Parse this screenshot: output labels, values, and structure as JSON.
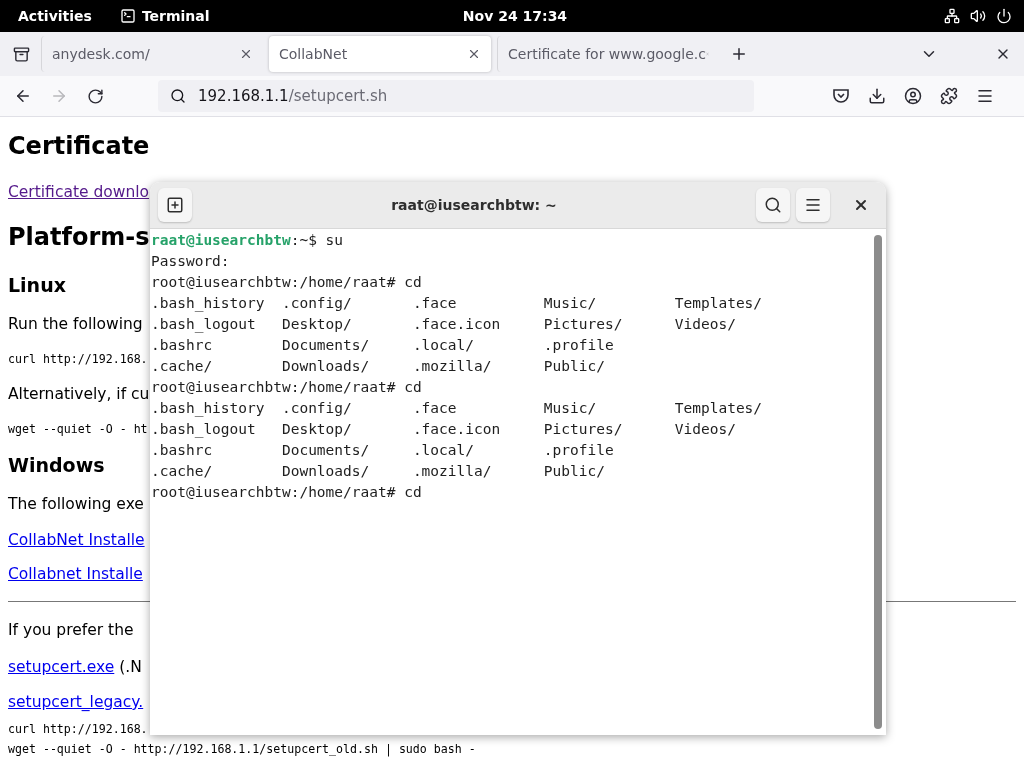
{
  "top_bar": {
    "activities": "Activities",
    "app": "Terminal",
    "clock": "Nov 24  17:34"
  },
  "browser": {
    "tabs": [
      {
        "title": "anydesk.com/",
        "selected": false
      },
      {
        "title": "CollabNet",
        "selected": true
      },
      {
        "title": "Certificate for www.google.c",
        "selected": false
      }
    ],
    "forward_disabled": true,
    "address": {
      "host": "192.168.1.1",
      "path": "/setupcert.sh"
    }
  },
  "page": [
    {
      "kind": "h1",
      "text": "Certificate"
    },
    {
      "kind": "link",
      "text": "Certificate downlo",
      "visited": true
    },
    {
      "kind": "h2",
      "text": "Platform-s"
    },
    {
      "kind": "h3",
      "text": "Linux"
    },
    {
      "kind": "p",
      "text": "Run the following"
    },
    {
      "kind": "code",
      "text": "curl http://192.168."
    },
    {
      "kind": "p",
      "text": "Alternatively, if cu"
    },
    {
      "kind": "code",
      "text": "wget --quiet -O - ht"
    },
    {
      "kind": "h3",
      "text": "Windows"
    },
    {
      "kind": "p",
      "text": "The following exe"
    },
    {
      "kind": "link",
      "text": "CollabNet Installe",
      "visited": false
    },
    {
      "kind": "link",
      "text": "Collabnet Installe",
      "visited": false
    },
    {
      "kind": "hr"
    },
    {
      "kind": "p",
      "text": "If you prefer the"
    },
    {
      "kind": "linkline",
      "link": "setupcert.exe",
      "text": "(.N"
    },
    {
      "kind": "link",
      "text": "setupcert_legacy.",
      "visited": false
    },
    {
      "kind": "pre",
      "text": "curl http://192.168."
    },
    {
      "kind": "pre",
      "text": "wget --quiet -O - http://192.168.1.1/setupcert_old.sh | sudo bash -"
    }
  ],
  "terminal": {
    "title": "raat@iusearchbtw: ~",
    "lines": [
      {
        "kind": "prompt",
        "user": "raat@iusearchbtw",
        "rest": ":~$ su"
      },
      {
        "kind": "text",
        "text": "Password:"
      },
      {
        "kind": "text",
        "text": "root@iusearchbtw:/home/raat# cd"
      },
      {
        "kind": "text",
        "text": ".bash_history  .config/       .face          Music/         Templates/"
      },
      {
        "kind": "text",
        "text": ".bash_logout   Desktop/       .face.icon     Pictures/      Videos/"
      },
      {
        "kind": "text",
        "text": ".bashrc        Documents/     .local/        .profile"
      },
      {
        "kind": "text",
        "text": ".cache/        Downloads/     .mozilla/      Public/"
      },
      {
        "kind": "text",
        "text": "root@iusearchbtw:/home/raat# cd"
      },
      {
        "kind": "text",
        "text": ".bash_history  .config/       .face          Music/         Templates/"
      },
      {
        "kind": "text",
        "text": ".bash_logout   Desktop/       .face.icon     Pictures/      Videos/"
      },
      {
        "kind": "text",
        "text": ".bashrc        Documents/     .local/        .profile"
      },
      {
        "kind": "text",
        "text": ".cache/        Downloads/     .mozilla/      Public/"
      },
      {
        "kind": "text",
        "text": "root@iusearchbtw:/home/raat# cd"
      }
    ]
  }
}
